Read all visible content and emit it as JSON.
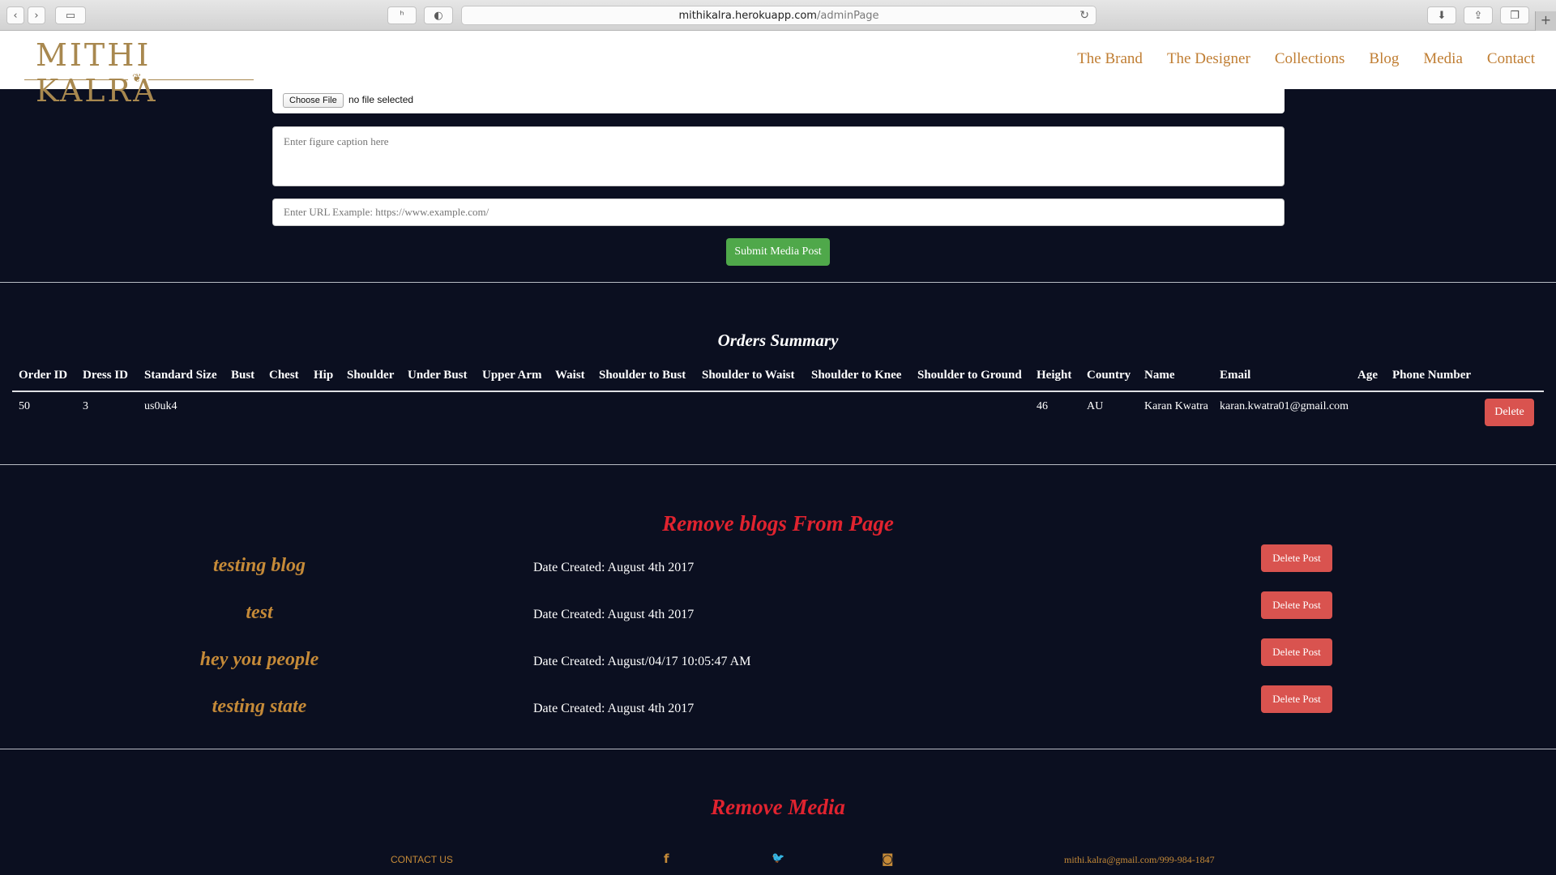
{
  "browser": {
    "url_host": "mithikalra.herokuapp.com",
    "url_path": "/adminPage",
    "back_icon": "‹",
    "forward_icon": "›",
    "sidebar_icon": "▭",
    "reader_icon": "ʰ",
    "extension_icon": "◐",
    "reload_icon": "↻",
    "download_icon": "⬇",
    "share_icon": "⇪",
    "tabs_icon": "❐",
    "new_tab_icon": "+"
  },
  "header": {
    "logo": "MITHI KALRA",
    "logo_mark": "❦",
    "nav": [
      "The Brand",
      "The Designer",
      "Collections",
      "Blog",
      "Media",
      "Contact"
    ]
  },
  "media_form": {
    "choose_file_label": "Choose File",
    "file_status": "no file selected",
    "caption_placeholder": "Enter figure caption here",
    "url_placeholder": "Enter URL Example: https://www.example.com/",
    "submit_label": "Submit Media Post"
  },
  "orders": {
    "title": "Orders Summary",
    "columns": [
      "Order ID",
      "Dress ID",
      "Standard Size",
      "Bust",
      "Chest",
      "Hip",
      "Shoulder",
      "Under Bust",
      "Upper Arm",
      "Waist",
      "Shoulder to Bust",
      "Shoulder to Waist",
      "Shoulder to Knee",
      "Shoulder to Ground",
      "Height",
      "Country",
      "Name",
      "Email",
      "Age",
      "Phone Number"
    ],
    "rows": [
      {
        "order_id": "50",
        "dress_id": "3",
        "standard_size": "us0uk4",
        "height": "46",
        "country": "AU",
        "name": "Karan Kwatra",
        "email": "karan.kwatra01@gmail.com",
        "delete_label": "Delete"
      }
    ]
  },
  "blogs": {
    "title": "Remove blogs From Page",
    "items": [
      {
        "title": "testing blog",
        "date": "Date Created: August 4th 2017",
        "delete_label": "Delete Post"
      },
      {
        "title": "test",
        "date": "Date Created: August 4th 2017",
        "delete_label": "Delete Post"
      },
      {
        "title": "hey you people",
        "date": "Date Created: August/04/17 10:05:47 AM",
        "delete_label": "Delete Post"
      },
      {
        "title": "testing state",
        "date": "Date Created: August 4th 2017",
        "delete_label": "Delete Post"
      }
    ]
  },
  "media_section": {
    "title": "Remove Media"
  },
  "footer": {
    "contact_label": "CONTACT US",
    "facebook_icon": "f",
    "twitter_icon": "🐦",
    "instagram_icon": "◙",
    "email_phone": "mithi.kalra@gmail.com/999-984-1847"
  },
  "colors": {
    "background": "#0b0f20",
    "gold": "#c58a38",
    "delete_red": "#d9534f",
    "section_red": "#e0232f",
    "submit_green": "#4fa84a"
  }
}
